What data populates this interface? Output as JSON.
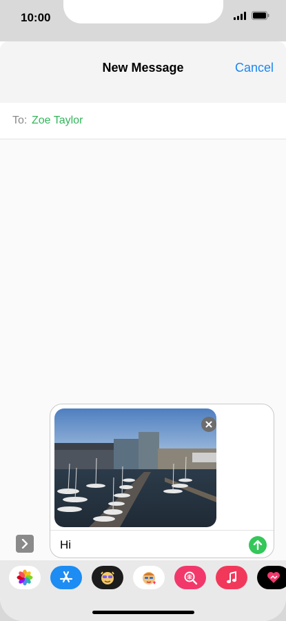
{
  "status_bar": {
    "time": "10:00"
  },
  "header": {
    "title": "New Message",
    "cancel_label": "Cancel"
  },
  "recipient": {
    "label": "To:",
    "name": "Zoe Taylor"
  },
  "compose": {
    "text": "Hi"
  },
  "app_drawer": {
    "items": [
      {
        "name": "Photos",
        "icon": "photos-icon"
      },
      {
        "name": "App Store",
        "icon": "app-store-icon"
      },
      {
        "name": "Memoji",
        "icon": "memoji-icon"
      },
      {
        "name": "Memoji Stickers",
        "icon": "memoji-stickers-icon"
      },
      {
        "name": "Images",
        "icon": "search-images-icon"
      },
      {
        "name": "Music",
        "icon": "music-icon"
      },
      {
        "name": "Digital Touch",
        "icon": "digital-touch-icon"
      }
    ]
  },
  "colors": {
    "accent_blue": "#1a86f2",
    "recipient_green": "#33b55a",
    "send_green": "#34c759"
  }
}
